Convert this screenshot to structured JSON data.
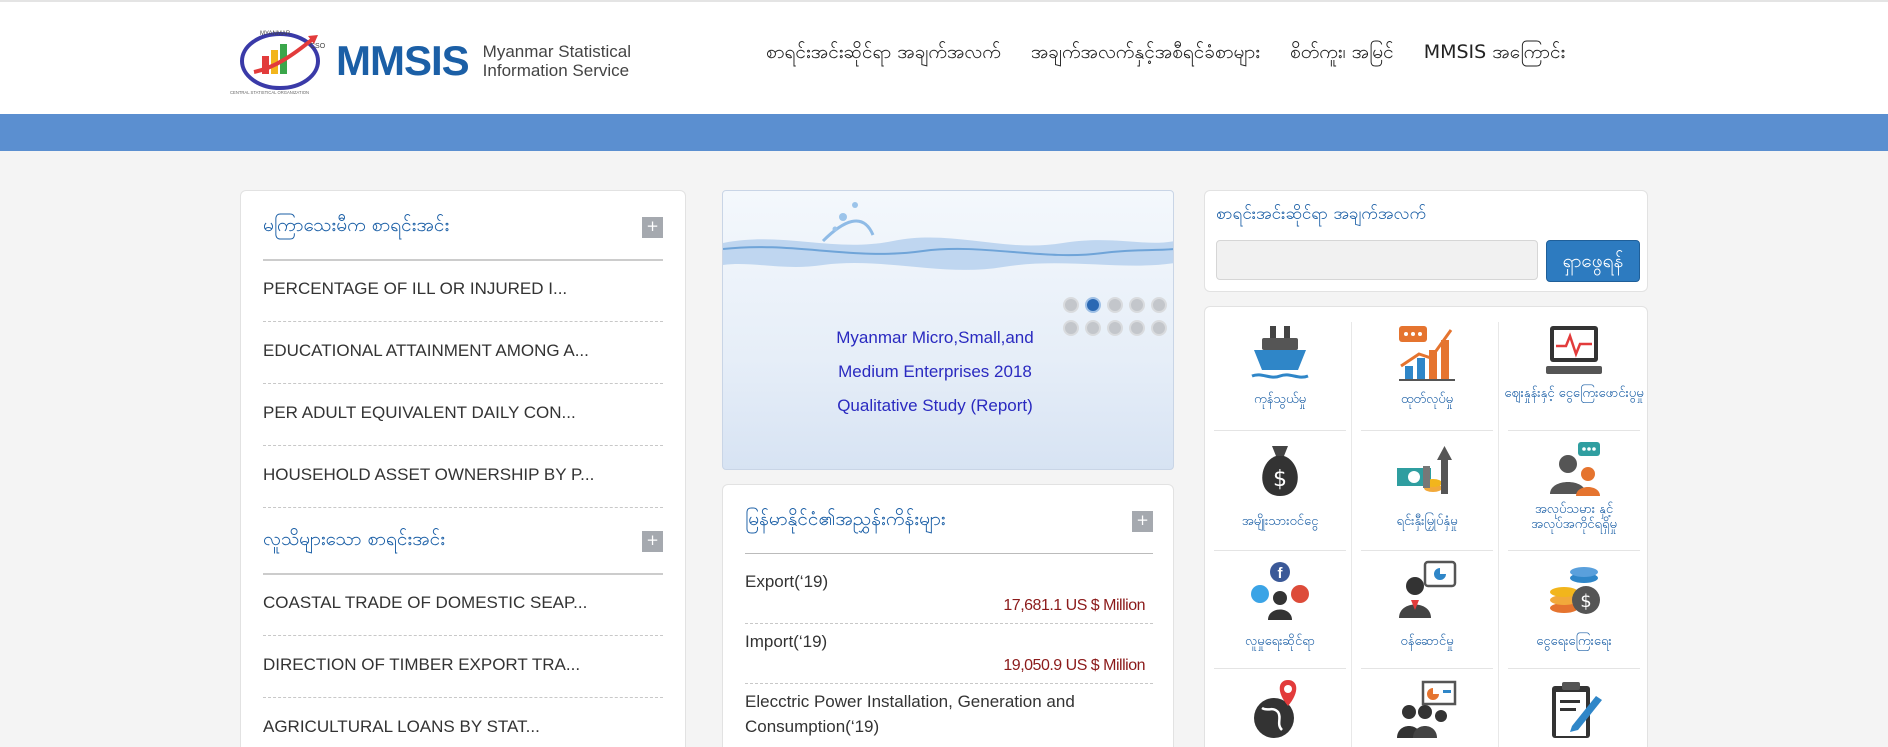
{
  "header": {
    "logo_name": "MMSIS",
    "logo_sub_line1": "Myanmar Statistical",
    "logo_sub_line2": "Information Service",
    "logo_seal_top": "MYANMAR",
    "logo_seal_right": "CSO",
    "logo_seal_bottom": "CENTRAL STATISTICAL ORGANIZATION",
    "nav": [
      {
        "label": "စာရင်းအင်းဆိုင်ရာ အချက်အလက်"
      },
      {
        "label": "အချက်အလက်နှင့်အစီရင်ခံစာများ"
      },
      {
        "label": "စိတ်ကူး၊ အမြင်"
      },
      {
        "label": "MMSIS အကြောင်း"
      }
    ]
  },
  "left_panel": {
    "section1_title": "မကြာသေးမီက စာရင်းအင်း",
    "section1_items": [
      {
        "label": "PERCENTAGE OF ILL OR INJURED I..."
      },
      {
        "label": "EDUCATIONAL ATTAINMENT AMONG A..."
      },
      {
        "label": "PER ADULT EQUIVALENT DAILY CON..."
      },
      {
        "label": "HOUSEHOLD ASSET OWNERSHIP BY P..."
      }
    ],
    "section2_title": "လူသိများသော စာရင်းအင်း",
    "section2_items": [
      {
        "label": "COASTAL TRADE OF DOMESTIC SEAP..."
      },
      {
        "label": "DIRECTION OF TIMBER EXPORT TRA..."
      },
      {
        "label": "AGRICULTURAL LOANS BY STAT..."
      }
    ],
    "plus_label": "+"
  },
  "slider": {
    "line1": "Myanmar Micro,Small,and",
    "line2": "Medium Enterprises 2018",
    "line3": "Qualitative Study (Report)",
    "active_dot": 2,
    "dot_count": 10
  },
  "indicators": {
    "title": "မြန်မာနိုင်ငံ၏အညွှန်းကိန်းများ",
    "plus_label": "+",
    "items": [
      {
        "label": "Export(‘19)",
        "value": "17,681.1 US $ Million"
      },
      {
        "label": "Import(‘19)",
        "value": "19,050.9 US $ Million"
      },
      {
        "label": "Elecctric Power Installation, Generation and Consumption(‘19)",
        "value": ""
      }
    ]
  },
  "search": {
    "title": "စာရင်းအင်းဆိုင်ရာ အချက်အလက်",
    "placeholder": "",
    "button_label": "ရှာဖွေရန်"
  },
  "categories": [
    {
      "label": "ကုန်သွယ်မှု",
      "icon": "ship-icon"
    },
    {
      "label": "ထုတ်လုပ်မှု",
      "icon": "growth-chart-icon"
    },
    {
      "label": "ဈေးနှုန်းနှင့် ငွေကြေးဖောင်းပွမှု",
      "icon": "monitor-pulse-icon"
    },
    {
      "label": "အမျိုးသားဝင်ငွေ",
      "icon": "money-bag-icon"
    },
    {
      "label": "ရင်းနှီးမြှုပ်နှံမှု",
      "icon": "investment-icon"
    },
    {
      "label": "အလုပ်သမား နှင့် အလုပ်အကိုင်ရရှိမှု",
      "icon": "labor-icon"
    },
    {
      "label": "လူမှုရေးဆိုင်ရာ",
      "icon": "social-icon"
    },
    {
      "label": "ဝန်ဆောင်မှု",
      "icon": "service-icon"
    },
    {
      "label": "ငွေရေးကြေးရေး",
      "icon": "finance-coins-icon"
    },
    {
      "label": "",
      "icon": "globe-pin-icon"
    },
    {
      "label": "",
      "icon": "presentation-icon"
    },
    {
      "label": "",
      "icon": "clipboard-icon"
    }
  ],
  "colors": {
    "brand_blue": "#1b5fa6",
    "band_blue": "#5b8fd0",
    "value_red": "#8b1a1a"
  }
}
